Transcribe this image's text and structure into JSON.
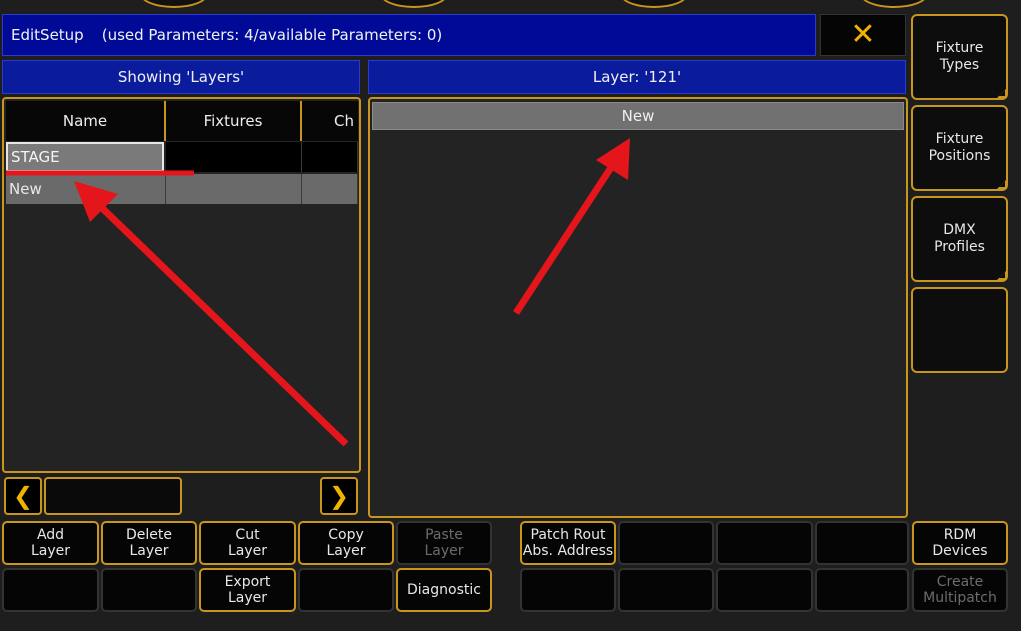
{
  "title": {
    "main": "EditSetup",
    "info": "(used Parameters: 4/available Parameters: 0)",
    "close_icon": "close-x-icon"
  },
  "left_header": "Showing 'Layers'",
  "right_header": "Layer: '121'",
  "table": {
    "columns": [
      "Name",
      "Fixtures",
      "Ch"
    ],
    "rows": [
      {
        "name": "STAGE",
        "fixtures": "",
        "ch": ""
      },
      {
        "name": "New",
        "fixtures": "",
        "ch": ""
      }
    ]
  },
  "right_list": {
    "new_label": "New"
  },
  "nav": {
    "prev_icon": "chevron-left-icon",
    "next_icon": "chevron-right-icon"
  },
  "side_buttons": [
    {
      "line1": "Fixture",
      "line2": "Types"
    },
    {
      "line1": "Fixture",
      "line2": "Positions"
    },
    {
      "line1": "DMX",
      "line2": "Profiles"
    },
    {
      "line1": "",
      "line2": ""
    }
  ],
  "bottom_row1": [
    {
      "line1": "Add",
      "line2": "Layer"
    },
    {
      "line1": "Delete",
      "line2": "Layer"
    },
    {
      "line1": "Cut",
      "line2": "Layer"
    },
    {
      "line1": "Copy",
      "line2": "Layer"
    },
    {
      "line1": "Paste",
      "line2": "Layer"
    },
    {
      "line1": "Patch Rout",
      "line2": "Abs. Address"
    },
    {
      "line1": "",
      "line2": ""
    },
    {
      "line1": "",
      "line2": ""
    },
    {
      "line1": "",
      "line2": ""
    },
    {
      "line1": "RDM",
      "line2": "Devices"
    }
  ],
  "bottom_row2": [
    {
      "line1": "",
      "line2": ""
    },
    {
      "line1": "",
      "line2": ""
    },
    {
      "line1": "Export",
      "line2": "Layer"
    },
    {
      "line1": "",
      "line2": ""
    },
    {
      "line1": "Diagnostic",
      "line2": ""
    },
    {
      "line1": "",
      "line2": ""
    },
    {
      "line1": "",
      "line2": ""
    },
    {
      "line1": "",
      "line2": ""
    },
    {
      "line1": "",
      "line2": ""
    },
    {
      "line1": "Create",
      "line2": "Multipatch"
    }
  ],
  "colors": {
    "accent": "#c8961e",
    "title_bg": "#000a96",
    "annotation": "#e4161b"
  }
}
